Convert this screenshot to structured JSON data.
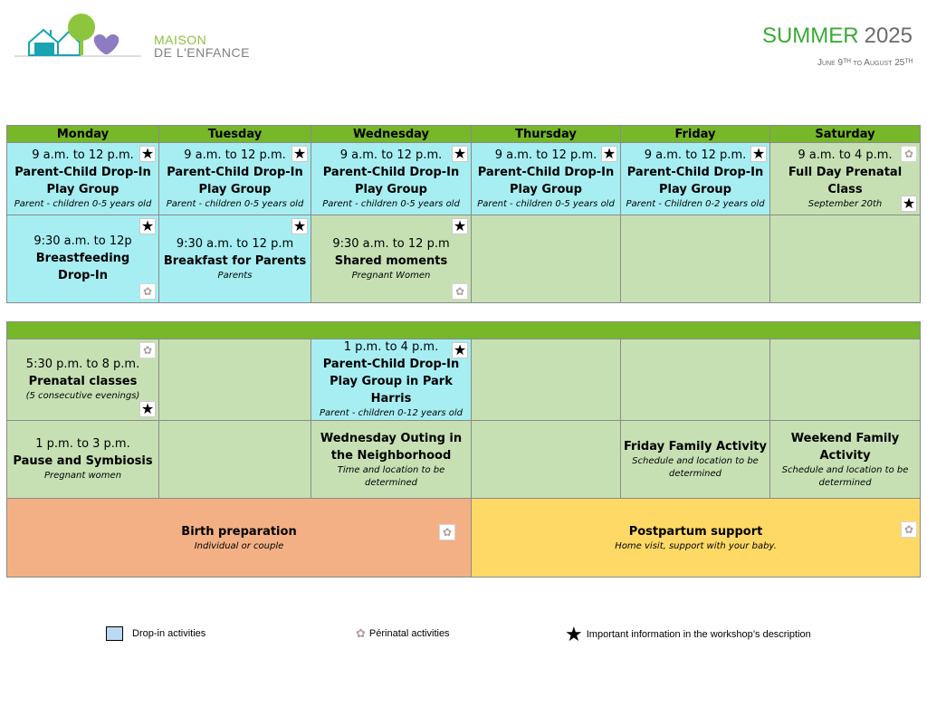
{
  "header": {
    "logo": {
      "line1": "MAISON",
      "line2": "DE L'ENFANCE",
      "colors": {
        "house": "#1aa3b3",
        "tree": "#8cc63f",
        "heart": "#8e7cc3"
      }
    },
    "season": "SUMMER",
    "year": "2025",
    "dates": "June 9ᵀᴴ to August 25ᵀᴴ"
  },
  "colors": {
    "header_bar": "#76b82a",
    "drop_in": "#a6eef2",
    "perinatal": "#c6e0b4",
    "birth": "#f3b084",
    "postpartum": "#ffd966"
  },
  "icons": {
    "star": "★",
    "flower": "✿"
  },
  "days": [
    "Monday",
    "Tuesday",
    "Wednesday",
    "Thursday",
    "Friday",
    "Saturday"
  ],
  "morning": {
    "row1": [
      {
        "time": "9 a.m. to 12 p.m.",
        "name": "Parent-Child Drop-In",
        "name2": "Play Group",
        "sub": "Parent - children 0-5 years old"
      },
      {
        "time": "9 a.m. to 12 p.m.",
        "name": "Parent-Child Drop-In",
        "name2": "Play Group",
        "sub": "Parent - children 0-5 years old"
      },
      {
        "time": "9 a.m. to 12 p.m.",
        "name": "Parent-Child Drop-In",
        "name2": "Play Group",
        "sub": "Parent - children 0-5 years old"
      },
      {
        "time": "9 a.m. to 12 p.m.",
        "name": "Parent-Child Drop-In",
        "name2": "Play Group",
        "sub": "Parent - children 0-5 years old"
      },
      {
        "time": "9 a.m. to 12 p.m.",
        "name": "Parent-Child Drop-In",
        "name2": "Play Group",
        "sub": "Parent - Children 0-2 years old"
      },
      {
        "time": "9 a.m. to 4 p.m.",
        "name": "Full Day Prenatal Class",
        "sub": "September 20th"
      }
    ],
    "row2": [
      {
        "time": "9:30 a.m. to 12p",
        "name": "Breastfeeding",
        "name2": "Drop-In"
      },
      {
        "time": "9:30 a.m. to 12 p.m",
        "name": "Breakfast for Parents",
        "sub": "Parents"
      },
      {
        "time": "9:30 a.m. to 12 p.m",
        "name": "Shared moments",
        "sub": "Pregnant Women"
      }
    ]
  },
  "afternoon": {
    "row1": {
      "monday": {
        "time": "5:30 p.m. to 8 p.m.",
        "name": "Prenatal classes",
        "sub": "(5 consecutive evenings)"
      },
      "wednesday": {
        "time": "1 p.m. to 4 p.m.",
        "name": "Parent-Child Drop-In",
        "name2": "Play Group in Park Harris",
        "sub": "Parent - children 0-12 years old"
      }
    },
    "row2": {
      "monday": {
        "time": "1 p.m. to 3 p.m.",
        "name": "Pause and Symbiosis",
        "sub": "Pregnant women"
      },
      "wednesday": {
        "name": "Wednesday Outing in",
        "name2": "the Neighborhood",
        "sub": "Time and location to be",
        "sub2": "determined"
      },
      "friday": {
        "name": "Friday Family Activity",
        "sub": "Schedule and location to be",
        "sub2": "determined"
      },
      "saturday": {
        "name": "Weekend Family",
        "name2": "Activity",
        "sub": "Schedule and location to be",
        "sub2": "determined"
      }
    },
    "birth": {
      "name": "Birth preparation",
      "sub": "Individual or couple"
    },
    "postpartum": {
      "name": "Postpartum support",
      "sub": "Home visit, support with your baby."
    }
  },
  "legend": {
    "drop_in": "Drop-in activities",
    "perinatal": "Périnatal activities",
    "important": "Important information in the workshop’s description"
  }
}
